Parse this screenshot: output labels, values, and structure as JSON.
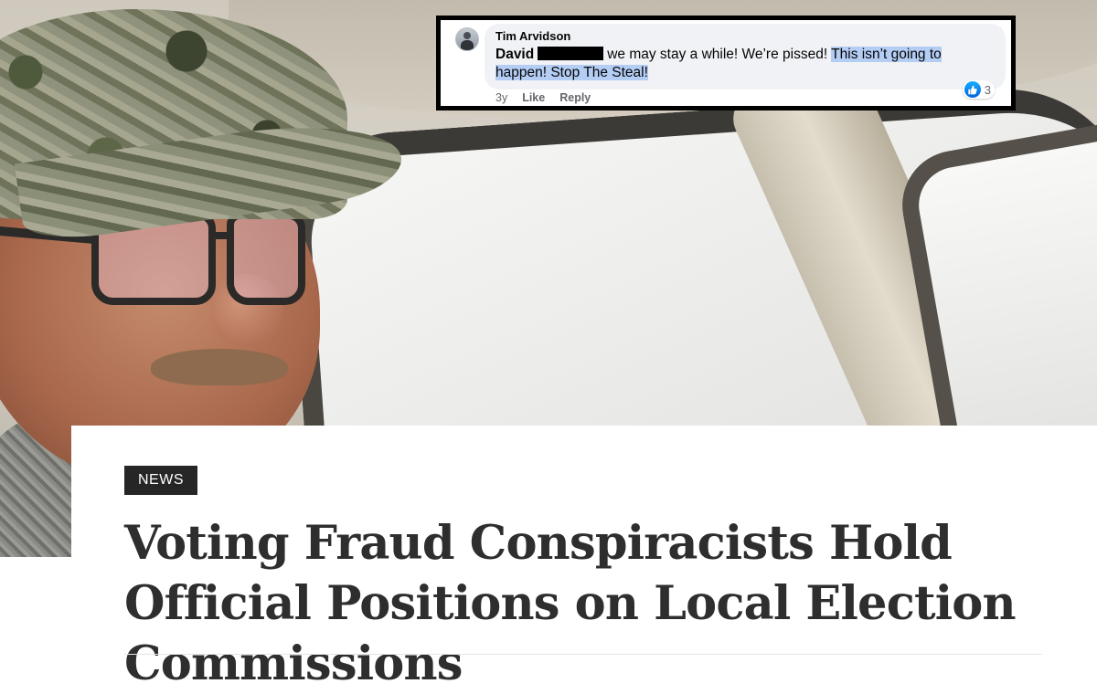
{
  "comment": {
    "author": "Tim Arvidson",
    "mention": "David",
    "text_before_highlight": "we may stay a while! We’re pissed!",
    "highlighted_text": "This isn’t going to happen! Stop The Steal!",
    "age": "3y",
    "like_label": "Like",
    "reply_label": "Reply",
    "reaction_count": "3",
    "reaction_icon": "thumbs-up-icon"
  },
  "article": {
    "category": "NEWS",
    "headline": "Voting Fraud Conspiracists Hold Official Positions on Local Election Commissions"
  },
  "colors": {
    "highlight": "#b4cdf5",
    "like_blue": "#0866ff",
    "tag_bg": "#262626",
    "headline_text": "#2e2e2e"
  }
}
